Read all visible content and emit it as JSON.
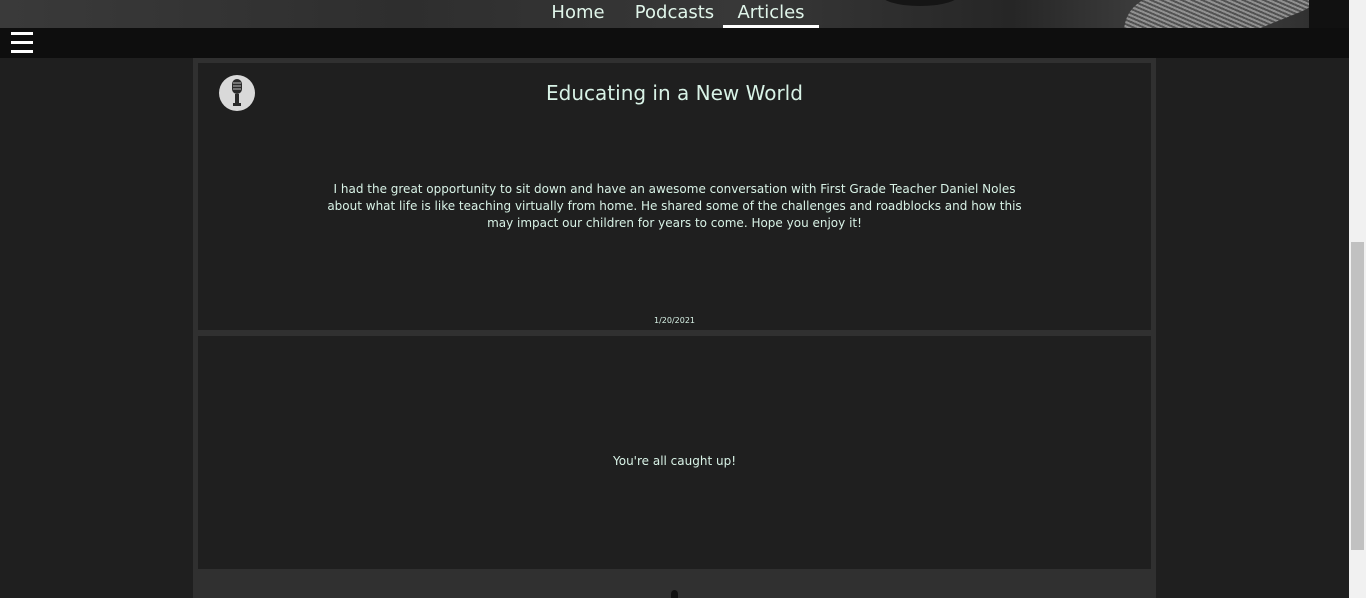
{
  "nav": {
    "items": [
      {
        "label": "Home"
      },
      {
        "label": "Podcasts"
      },
      {
        "label": "Articles"
      }
    ],
    "active": "Articles"
  },
  "menu": {
    "icon": "hamburger-menu-icon"
  },
  "article": {
    "avatar_icon": "microphone-icon",
    "title": "Educating in a New World",
    "body": "I had the great opportunity to sit down and have an awesome conversation with First Grade Teacher Daniel Noles about what life is like teaching virtually from home. He shared some of the challenges and roadblocks and how this may impact our children for years to come. Hope you enjoy it!",
    "date": "1/20/2021"
  },
  "feed_end": {
    "message": "You're all caught up!"
  },
  "colors": {
    "background": "#1f1f1f",
    "text": "#d8f2e6",
    "menubar": "#0e0e0e",
    "column": "#303030"
  }
}
